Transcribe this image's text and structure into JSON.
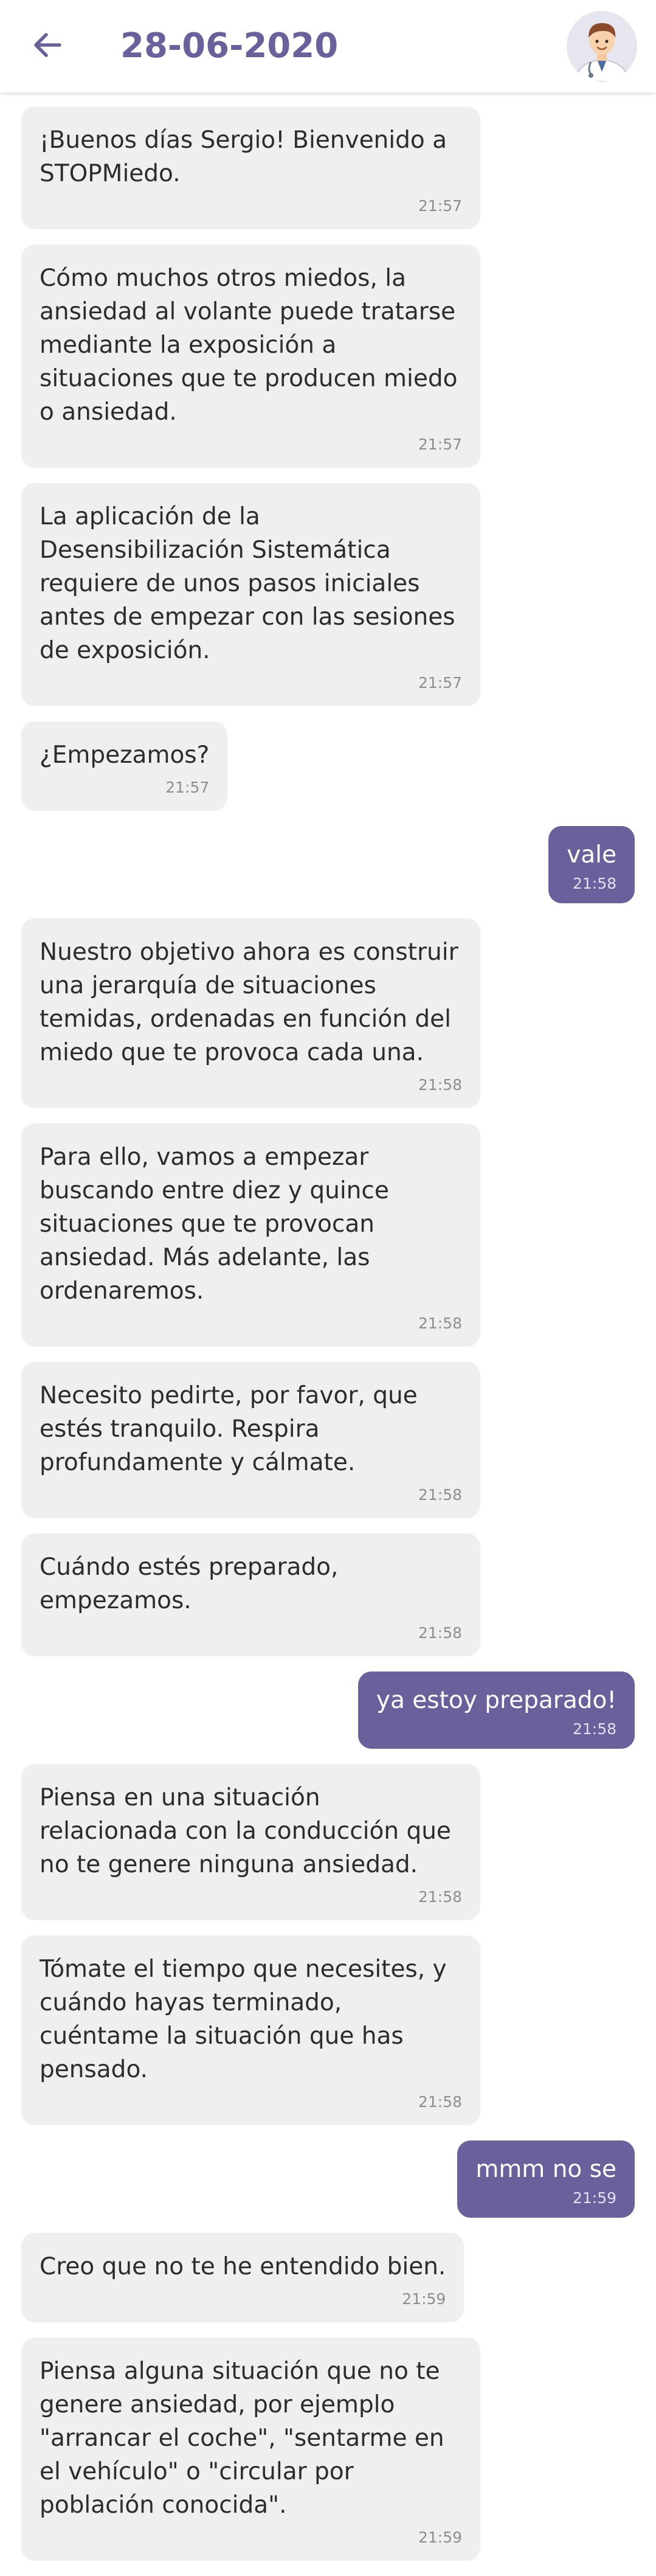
{
  "header": {
    "title": "28-06-2020",
    "back_icon": "arrow-left-icon",
    "avatar_icon": "doctor-avatar"
  },
  "colors": {
    "accent": "#6b5f9c",
    "bot_bubble": "#efefef",
    "user_bubble": "#6b5f9c"
  },
  "messages": [
    {
      "from": "bot",
      "text": "¡Buenos días Sergio! Bienvenido a STOPMiedo.",
      "time": "21:57"
    },
    {
      "from": "bot",
      "text": "Cómo muchos otros miedos, la ansiedad al volante puede tratarse mediante la exposición a situaciones que te producen miedo o ansiedad.",
      "time": "21:57"
    },
    {
      "from": "bot",
      "text": "La aplicación de la Desensibilización Sistemática requiere de unos pasos iniciales antes de empezar con las sesiones de exposición.",
      "time": "21:57"
    },
    {
      "from": "bot",
      "text": "¿Empezamos?",
      "time": "21:57"
    },
    {
      "from": "user",
      "text": "vale",
      "time": "21:58"
    },
    {
      "from": "bot",
      "text": "Nuestro objetivo ahora es construir una jerarquía de situaciones temidas, ordenadas en función del miedo que te provoca cada una.",
      "time": "21:58"
    },
    {
      "from": "bot",
      "text": "Para ello, vamos a empezar buscando entre diez y quince situaciones que te provocan ansiedad. Más adelante, las ordenaremos.",
      "time": "21:58"
    },
    {
      "from": "bot",
      "text": "Necesito pedirte, por favor, que estés tranquilo. Respira profundamente y cálmate.",
      "time": "21:58"
    },
    {
      "from": "bot",
      "text": "Cuándo estés preparado, empezamos.",
      "time": "21:58"
    },
    {
      "from": "user",
      "text": "ya estoy preparado!",
      "time": "21:58"
    },
    {
      "from": "bot",
      "text": "Piensa en una situación relacionada con la conducción que no te genere ninguna ansiedad.",
      "time": "21:58"
    },
    {
      "from": "bot",
      "text": "Tómate el tiempo que necesites, y cuándo hayas terminado, cuéntame la situación que has pensado.",
      "time": "21:58"
    },
    {
      "from": "user",
      "text": "mmm no se",
      "time": "21:59"
    },
    {
      "from": "bot",
      "text": "Creo que no te he entendido bien.",
      "time": "21:59"
    },
    {
      "from": "bot",
      "text": "Piensa alguna situación que no te genere ansiedad, por ejemplo \"arrancar el coche\", \"sentarme en el vehículo\" o \"circular por población conocida\".",
      "time": "21:59"
    }
  ]
}
